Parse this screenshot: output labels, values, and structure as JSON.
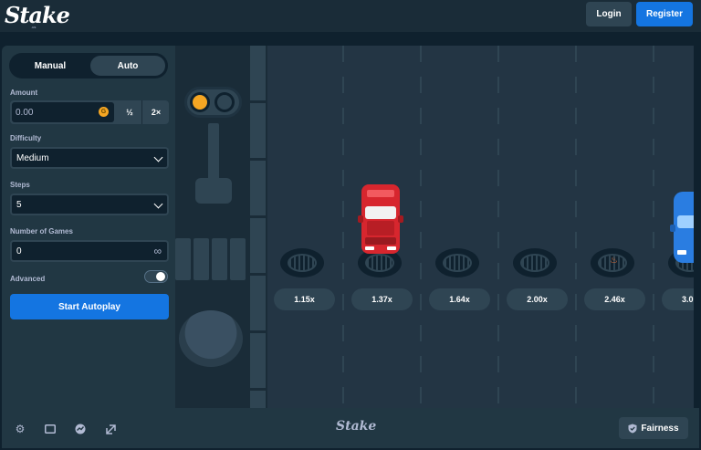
{
  "header": {
    "logo": "Stake",
    "logo_sub": ".us",
    "login_label": "Login",
    "register_label": "Register"
  },
  "sidebar": {
    "tabs": [
      {
        "label": "Manual",
        "active": false
      },
      {
        "label": "Auto",
        "active": true
      }
    ],
    "amount": {
      "label": "Amount",
      "value": "0.00",
      "coin": "G",
      "half_label": "½",
      "double_label": "2×"
    },
    "difficulty": {
      "label": "Difficulty",
      "value": "Medium"
    },
    "steps": {
      "label": "Steps",
      "value": "5"
    },
    "number_of_games": {
      "label": "Number of Games",
      "value": "0",
      "icon": "infinity-icon"
    },
    "advanced": {
      "label": "Advanced",
      "enabled": false
    },
    "start_label": "Start Autoplay"
  },
  "game": {
    "multipliers": [
      "1.15x",
      "1.37x",
      "1.64x",
      "2.00x",
      "2.46x",
      "3.0"
    ],
    "traffic_light": {
      "active": "yellow"
    }
  },
  "footer": {
    "icons": [
      "settings-icon",
      "theater-mode-icon",
      "stats-icon",
      "popout-icon"
    ],
    "logo": "Stake",
    "fairness_label": "Fairness"
  },
  "colors": {
    "background": "#0f212e",
    "panel": "#213743",
    "accent_blue": "#1475e1",
    "button_gray": "#2f4553",
    "coin_gold": "#f5a623"
  }
}
